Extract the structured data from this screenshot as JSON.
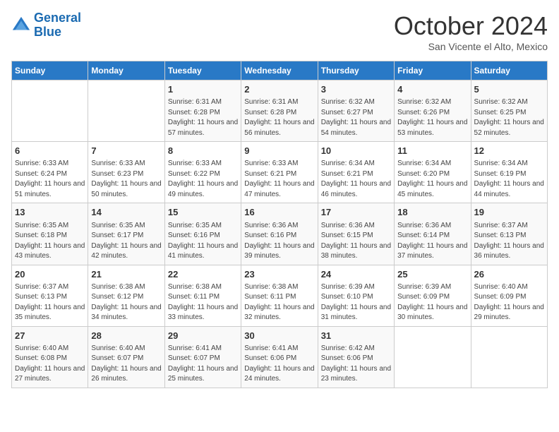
{
  "header": {
    "logo_line1": "General",
    "logo_line2": "Blue",
    "month": "October 2024",
    "location": "San Vicente el Alto, Mexico"
  },
  "days_of_week": [
    "Sunday",
    "Monday",
    "Tuesday",
    "Wednesday",
    "Thursday",
    "Friday",
    "Saturday"
  ],
  "weeks": [
    [
      {
        "day": "",
        "info": ""
      },
      {
        "day": "",
        "info": ""
      },
      {
        "day": "1",
        "info": "Sunrise: 6:31 AM\nSunset: 6:28 PM\nDaylight: 11 hours and 57 minutes."
      },
      {
        "day": "2",
        "info": "Sunrise: 6:31 AM\nSunset: 6:28 PM\nDaylight: 11 hours and 56 minutes."
      },
      {
        "day": "3",
        "info": "Sunrise: 6:32 AM\nSunset: 6:27 PM\nDaylight: 11 hours and 54 minutes."
      },
      {
        "day": "4",
        "info": "Sunrise: 6:32 AM\nSunset: 6:26 PM\nDaylight: 11 hours and 53 minutes."
      },
      {
        "day": "5",
        "info": "Sunrise: 6:32 AM\nSunset: 6:25 PM\nDaylight: 11 hours and 52 minutes."
      }
    ],
    [
      {
        "day": "6",
        "info": "Sunrise: 6:33 AM\nSunset: 6:24 PM\nDaylight: 11 hours and 51 minutes."
      },
      {
        "day": "7",
        "info": "Sunrise: 6:33 AM\nSunset: 6:23 PM\nDaylight: 11 hours and 50 minutes."
      },
      {
        "day": "8",
        "info": "Sunrise: 6:33 AM\nSunset: 6:22 PM\nDaylight: 11 hours and 49 minutes."
      },
      {
        "day": "9",
        "info": "Sunrise: 6:33 AM\nSunset: 6:21 PM\nDaylight: 11 hours and 47 minutes."
      },
      {
        "day": "10",
        "info": "Sunrise: 6:34 AM\nSunset: 6:21 PM\nDaylight: 11 hours and 46 minutes."
      },
      {
        "day": "11",
        "info": "Sunrise: 6:34 AM\nSunset: 6:20 PM\nDaylight: 11 hours and 45 minutes."
      },
      {
        "day": "12",
        "info": "Sunrise: 6:34 AM\nSunset: 6:19 PM\nDaylight: 11 hours and 44 minutes."
      }
    ],
    [
      {
        "day": "13",
        "info": "Sunrise: 6:35 AM\nSunset: 6:18 PM\nDaylight: 11 hours and 43 minutes."
      },
      {
        "day": "14",
        "info": "Sunrise: 6:35 AM\nSunset: 6:17 PM\nDaylight: 11 hours and 42 minutes."
      },
      {
        "day": "15",
        "info": "Sunrise: 6:35 AM\nSunset: 6:16 PM\nDaylight: 11 hours and 41 minutes."
      },
      {
        "day": "16",
        "info": "Sunrise: 6:36 AM\nSunset: 6:16 PM\nDaylight: 11 hours and 39 minutes."
      },
      {
        "day": "17",
        "info": "Sunrise: 6:36 AM\nSunset: 6:15 PM\nDaylight: 11 hours and 38 minutes."
      },
      {
        "day": "18",
        "info": "Sunrise: 6:36 AM\nSunset: 6:14 PM\nDaylight: 11 hours and 37 minutes."
      },
      {
        "day": "19",
        "info": "Sunrise: 6:37 AM\nSunset: 6:13 PM\nDaylight: 11 hours and 36 minutes."
      }
    ],
    [
      {
        "day": "20",
        "info": "Sunrise: 6:37 AM\nSunset: 6:13 PM\nDaylight: 11 hours and 35 minutes."
      },
      {
        "day": "21",
        "info": "Sunrise: 6:38 AM\nSunset: 6:12 PM\nDaylight: 11 hours and 34 minutes."
      },
      {
        "day": "22",
        "info": "Sunrise: 6:38 AM\nSunset: 6:11 PM\nDaylight: 11 hours and 33 minutes."
      },
      {
        "day": "23",
        "info": "Sunrise: 6:38 AM\nSunset: 6:11 PM\nDaylight: 11 hours and 32 minutes."
      },
      {
        "day": "24",
        "info": "Sunrise: 6:39 AM\nSunset: 6:10 PM\nDaylight: 11 hours and 31 minutes."
      },
      {
        "day": "25",
        "info": "Sunrise: 6:39 AM\nSunset: 6:09 PM\nDaylight: 11 hours and 30 minutes."
      },
      {
        "day": "26",
        "info": "Sunrise: 6:40 AM\nSunset: 6:09 PM\nDaylight: 11 hours and 29 minutes."
      }
    ],
    [
      {
        "day": "27",
        "info": "Sunrise: 6:40 AM\nSunset: 6:08 PM\nDaylight: 11 hours and 27 minutes."
      },
      {
        "day": "28",
        "info": "Sunrise: 6:40 AM\nSunset: 6:07 PM\nDaylight: 11 hours and 26 minutes."
      },
      {
        "day": "29",
        "info": "Sunrise: 6:41 AM\nSunset: 6:07 PM\nDaylight: 11 hours and 25 minutes."
      },
      {
        "day": "30",
        "info": "Sunrise: 6:41 AM\nSunset: 6:06 PM\nDaylight: 11 hours and 24 minutes."
      },
      {
        "day": "31",
        "info": "Sunrise: 6:42 AM\nSunset: 6:06 PM\nDaylight: 11 hours and 23 minutes."
      },
      {
        "day": "",
        "info": ""
      },
      {
        "day": "",
        "info": ""
      }
    ]
  ]
}
